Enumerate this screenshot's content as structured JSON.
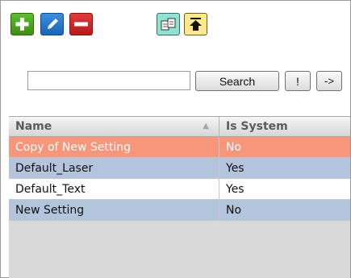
{
  "toolbar": {
    "buttons": [
      {
        "name": "add",
        "icon": "plus-icon"
      },
      {
        "name": "edit",
        "icon": "pencil-icon"
      },
      {
        "name": "remove",
        "icon": "minus-icon"
      },
      {
        "name": "copy",
        "icon": "copy-icon"
      },
      {
        "name": "up",
        "icon": "up-arrow-icon"
      }
    ]
  },
  "search": {
    "value": "",
    "button_label": "Search",
    "bang_label": "!",
    "arrow_label": "->"
  },
  "grid": {
    "columns": [
      "Name",
      "Is System"
    ],
    "rows": [
      {
        "name": "Copy of New Setting",
        "is_system": "No",
        "selected": true
      },
      {
        "name": "Default_Laser",
        "is_system": "Yes"
      },
      {
        "name": "Default_Text",
        "is_system": "Yes"
      },
      {
        "name": "New Setting",
        "is_system": "No"
      }
    ]
  },
  "colors": {
    "selected_row": "#f7967a",
    "alt_row": "#b3c4dd",
    "add_button": "#4aa21f",
    "edit_button": "#1f74cc",
    "remove_button": "#cc2424",
    "copy_button": "#8fe3cf",
    "up_button": "#ffe88a"
  }
}
